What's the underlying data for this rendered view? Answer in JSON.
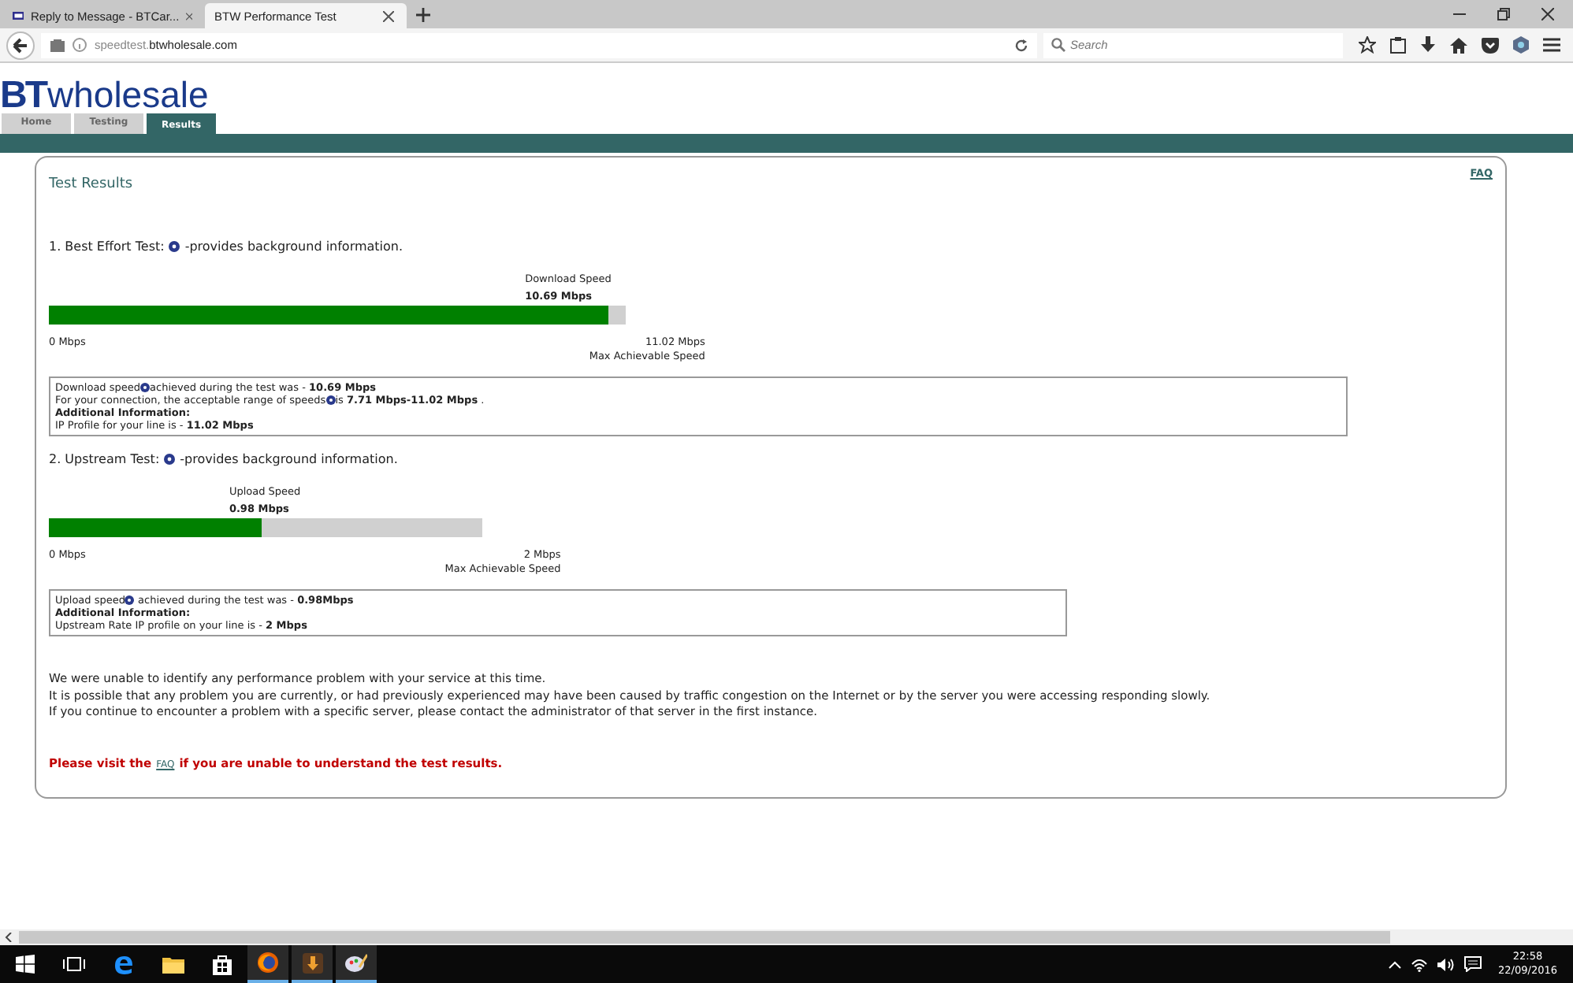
{
  "browser": {
    "tabs": [
      {
        "title": "Reply to Message - BTCar...",
        "selected": false
      },
      {
        "title": "BTW Performance Test",
        "selected": true
      }
    ],
    "url_host": "speedtest.",
    "url_domain": "btwholesale.com",
    "search": {
      "placeholder": "Search"
    }
  },
  "site": {
    "logo_bt": "BT",
    "logo_word": "wholesale",
    "nav": [
      {
        "label": "Home",
        "selected": false
      },
      {
        "label": "Testing",
        "selected": false
      },
      {
        "label": "Results",
        "selected": true
      }
    ]
  },
  "panel": {
    "faq": "FAQ",
    "title": "Test Results",
    "tests": [
      {
        "heading": "1. Best Effort Test:",
        "heading_note": "-provides background information.",
        "speed_label": "Download Speed",
        "speed_value": "10.69 Mbps",
        "level": 0.97,
        "min_label": "0 Mbps",
        "max_value": "11.02 Mbps",
        "max_label": "Max Achievable Speed",
        "lines": [
          {
            "before": "Download speed",
            "after": "achieved during the test was - **10.69 Mbps**"
          },
          {
            "before": "For your connection, the acceptable range of speeds",
            "after": "is **7.71 Mbps-11.02 Mbps** ."
          },
          {
            "text": "**Additional Information:**"
          },
          {
            "text": "IP Profile for your line is - **11.02 Mbps**"
          }
        ]
      },
      {
        "heading": "2. Upstream Test:",
        "heading_note": "-provides background information.",
        "speed_label": "Upload Speed",
        "speed_value": "0.98 Mbps",
        "level": 0.49,
        "min_label": "0 Mbps",
        "max_value": "2 Mbps",
        "max_label": "Max Achievable Speed",
        "lines": [
          {
            "before": "Upload speed",
            "after": " achieved during the test was - **0.98Mbps**"
          },
          {
            "text": "**Additional Information:**"
          },
          {
            "text": "Upstream Rate IP profile on your line is - **2 Mbps**"
          }
        ]
      }
    ],
    "messages": [
      "We were unable to identify any performance problem with your service at this time.",
      "It is possible that any problem you are currently, or had previously experienced may have been caused by traffic congestion on the Internet or by the server you were accessing responding slowly.",
      "If you continue to encounter a problem with a specific server, please contact the administrator of that server in the first instance."
    ],
    "notice_before": "Please visit the",
    "notice_link": "FAQ",
    "notice_after": "if you are unable to understand the test results."
  },
  "taskbar": {
    "time": "22:58",
    "date": "22/09/2016"
  }
}
